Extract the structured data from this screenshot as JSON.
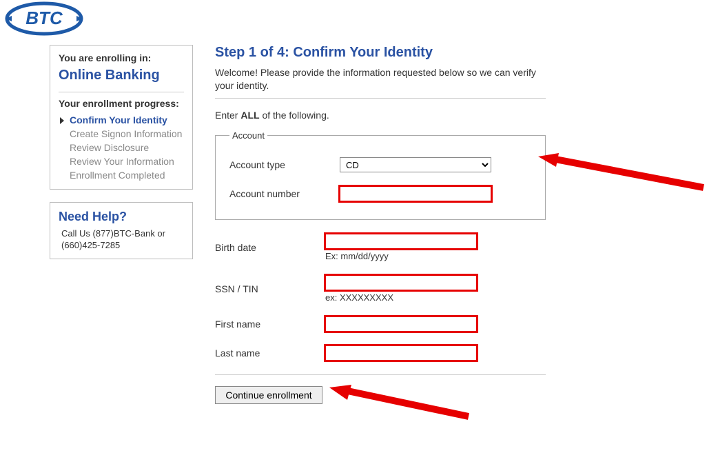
{
  "logo_text": "BTC",
  "sidebar": {
    "enroll_label": "You are enrolling in:",
    "enroll_title": "Online Banking",
    "progress_label": "Your enrollment progress:",
    "steps": [
      "Confirm Your Identity",
      "Create Signon Information",
      "Review Disclosure",
      "Review Your Information",
      "Enrollment Completed"
    ],
    "help_title": "Need Help?",
    "help_text": "Call Us  (877)BTC-Bank or (660)425-7285"
  },
  "main": {
    "step_title": "Step 1 of 4: Confirm Your Identity",
    "welcome": "Welcome! Please provide the information requested below so we can verify your identity.",
    "enter_all_prefix": "Enter ",
    "enter_all_bold": "ALL",
    "enter_all_suffix": " of the following.",
    "account_legend": "Account",
    "labels": {
      "account_type": "Account type",
      "account_number": "Account number",
      "birth_date": "Birth date",
      "birth_date_hint": "Ex: mm/dd/yyyy",
      "ssn": "SSN / TIN",
      "ssn_hint": "ex: XXXXXXXXX",
      "first_name": "First name",
      "last_name": "Last name"
    },
    "account_type_selected": "CD",
    "continue_label": "Continue enrollment"
  }
}
